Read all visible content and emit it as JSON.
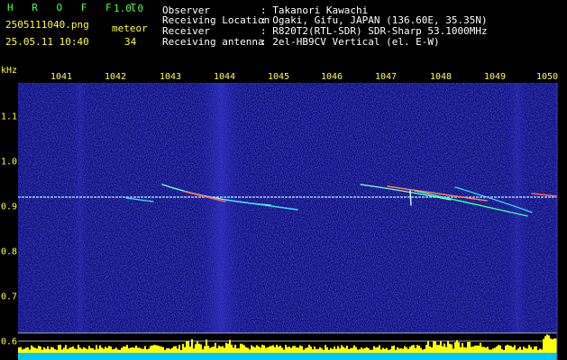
{
  "header": {
    "app_name": "H R O F F T",
    "version": "1.0.0",
    "filename": "2505111040.png",
    "datetime": "25.05.11 10:40",
    "count_label": "meteor",
    "count_value": "34",
    "info": [
      {
        "label": "Observer",
        "value": ": Takanori Kawachi"
      },
      {
        "label": "Receiving Location",
        "value": ": Ogaki, Gifu, JAPAN (136.60E, 35.35N)"
      },
      {
        "label": "Receiver",
        "value": ": R820T2(RTL-SDR) SDR-Sharp 53.1000MHz"
      },
      {
        "label": "Receiving antenna",
        "value": ": 2el-HB9CV Vertical (el. E-W)"
      }
    ]
  },
  "y_axis": {
    "unit": "kHz",
    "ticks": [
      "1.1",
      "1.0",
      "0.9",
      "0.8",
      "0.7",
      "0.6"
    ]
  },
  "x_axis": {
    "ticks": [
      "1041",
      "1042",
      "1043",
      "1044",
      "1045",
      "1046",
      "1047",
      "1048",
      "1049",
      "1050"
    ]
  },
  "colors": {
    "background": "#000000",
    "spectrogram": "#0a0a6e",
    "text_primary": "#ffff40",
    "text_header": "#4cff4c",
    "carrier": "#c8ffff",
    "bottom_bar": "#ffff00",
    "bottom_base": "#00c8ff"
  }
}
